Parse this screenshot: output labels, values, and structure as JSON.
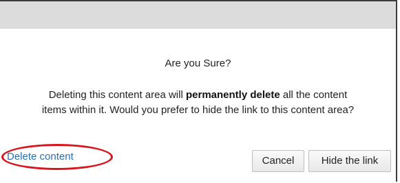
{
  "dialog": {
    "heading": "Are you Sure?",
    "message_before": "Deleting this content area will ",
    "message_bold": "permanently delete",
    "message_after": " all the content items within it. Would you prefer to hide the link to this content area?",
    "delete_link_label": "Delete content",
    "cancel_label": "Cancel",
    "hide_link_label": "Hide the link"
  },
  "colors": {
    "link": "#2a6fb5",
    "highlight_ring": "#d8141d",
    "title_bar": "#dcdcdc"
  }
}
